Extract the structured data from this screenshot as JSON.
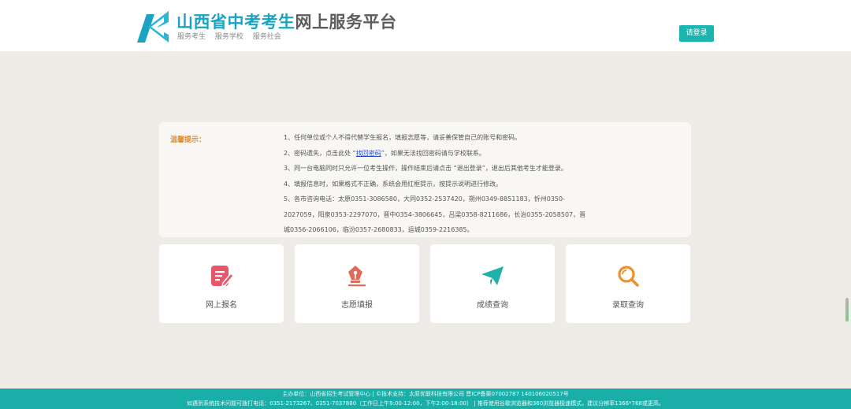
{
  "header": {
    "title_colored": "山西省中考考生",
    "title_plain": "网上服务平台",
    "subtitles": [
      "服务考生",
      "服务学校",
      "服务社会"
    ],
    "login_label": "请登录"
  },
  "notice": {
    "label": "温馨提示：",
    "item1": "1、任何单位或个人不得代替学生报名，填报志愿等，请妥善保管自己的账号和密码。",
    "item2_pre": "2、密码遗失，点击此处 “",
    "item2_link": "找回密码",
    "item2_post": "”，如果无法找回密码请与学校联系。",
    "item3": "3、同一台电脑同时只允许一位考生操作，操作结束后请点击 “退出登录”，退出后其他考生才能登录。",
    "item4": "4、填报信息时，如果格式不正确，系统会用红框提示，按提示说明进行修改。",
    "item5_line1": "5、各市咨询电话：太原0351-3086580，大同0352-2537420，朔州0349-8851183，忻州0350-",
    "item5_line2": "2027059，阳泉0353-2297070，晋中0354-3806645，吕梁0358-8211686，长治0355-2058507，晋",
    "item5_line3": "城0356-2066106，临汾0357-2680833，运城0359-2216385。"
  },
  "cards": [
    {
      "label": "网上报名",
      "icon": "edit-form-icon",
      "color": "#e8566a"
    },
    {
      "label": "志愿填报",
      "icon": "pen-nib-icon",
      "color": "#e26a5a"
    },
    {
      "label": "成绩查询",
      "icon": "paper-plane-icon",
      "color": "#1fb2ab"
    },
    {
      "label": "录取查询",
      "icon": "magnifier-icon",
      "color": "#f0902a"
    }
  ],
  "footer": {
    "line1": "主办单位：山西省招生考试管理中心  |  ©技术支持：太原优联科技有限公司  晋ICP备案07002787  140106020517号",
    "line2": "如遇到系统技术问题可拨打电话：0351-2173267、0351-7037880（工作日上午9:00-12:00，下午2:00-18:00）  |  推荐使用谷歌浏览器和360浏览器极速模式，建议分辨率1366*768或更高。"
  },
  "colors": {
    "brand": "#1aa3c4",
    "accent": "#1bb5b0",
    "background": "#efebe6"
  }
}
